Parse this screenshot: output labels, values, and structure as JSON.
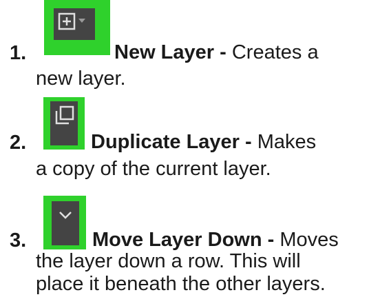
{
  "items": [
    {
      "number": "1.",
      "icon": "new-layer-icon",
      "title": "New Layer",
      "separator": " - ",
      "description_first": "Creates a",
      "description_rest": [
        "new layer."
      ]
    },
    {
      "number": "2.",
      "icon": "duplicate-layer-icon",
      "title": "Duplicate Layer",
      "separator": " - ",
      "description_first": "Makes",
      "description_rest": [
        "a copy of the current layer."
      ]
    },
    {
      "number": "3.",
      "icon": "move-layer-down-icon",
      "title": "Move Layer Down",
      "separator": " - ",
      "description_first": "Moves",
      "description_rest": [
        "the layer down a row. This will",
        "place it beneath the other layers."
      ]
    }
  ],
  "colors": {
    "highlight": "#2fd12c",
    "button_bg": "#444444",
    "icon_fg": "#e0e0e0"
  }
}
